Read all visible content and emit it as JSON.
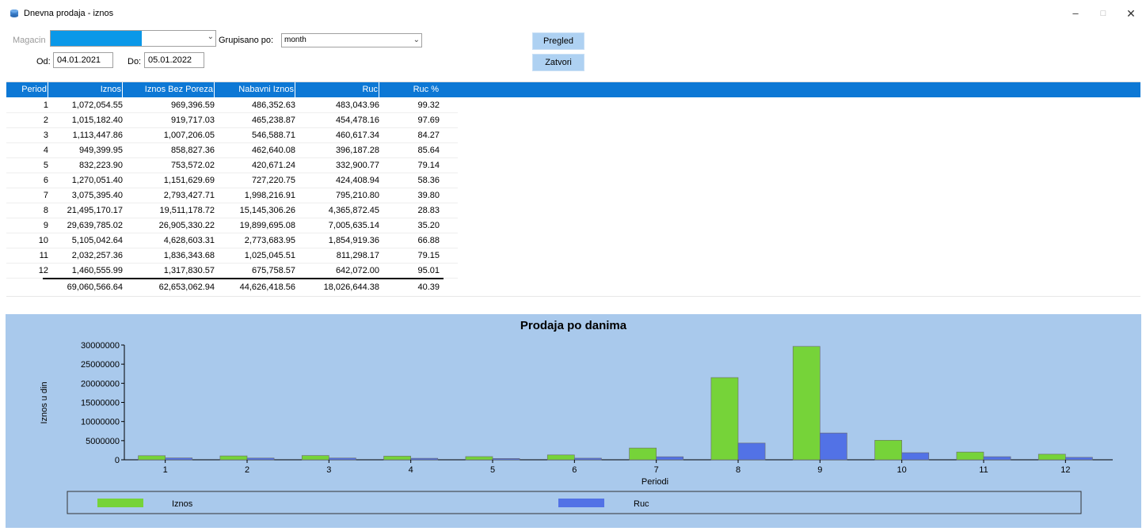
{
  "window": {
    "title": "Dnevna prodaja - iznos",
    "app_icon": "database-icon",
    "min_icon": "minimize-icon",
    "max_icon": "maximize-icon",
    "close_icon": "close-icon"
  },
  "filters": {
    "magacin_label": "Magacin",
    "grupisano_label": "Grupisano po:",
    "grupisano_value": "month",
    "od_label": "Od:",
    "od_value": "04.01.2021",
    "do_label": "Do:",
    "do_value": "05.01.2022",
    "selection_color": "#0a98e8"
  },
  "buttons": {
    "pregled": "Pregled",
    "zatvori": "Zatvori"
  },
  "grid": {
    "header_color": "#0d78d5",
    "columns": [
      "Period",
      "Iznos",
      "Iznos Bez Poreza",
      "Nabavni Iznos",
      "Ruc",
      "Ruc %"
    ],
    "rows": [
      [
        "1",
        "1,072,054.55",
        "969,396.59",
        "486,352.63",
        "483,043.96",
        "99.32"
      ],
      [
        "2",
        "1,015,182.40",
        "919,717.03",
        "465,238.87",
        "454,478.16",
        "97.69"
      ],
      [
        "3",
        "1,113,447.86",
        "1,007,206.05",
        "546,588.71",
        "460,617.34",
        "84.27"
      ],
      [
        "4",
        "949,399.95",
        "858,827.36",
        "462,640.08",
        "396,187.28",
        "85.64"
      ],
      [
        "5",
        "832,223.90",
        "753,572.02",
        "420,671.24",
        "332,900.77",
        "79.14"
      ],
      [
        "6",
        "1,270,051.40",
        "1,151,629.69",
        "727,220.75",
        "424,408.94",
        "58.36"
      ],
      [
        "7",
        "3,075,395.40",
        "2,793,427.71",
        "1,998,216.91",
        "795,210.80",
        "39.80"
      ],
      [
        "8",
        "21,495,170.17",
        "19,511,178.72",
        "15,145,306.26",
        "4,365,872.45",
        "28.83"
      ],
      [
        "9",
        "29,639,785.02",
        "26,905,330.22",
        "19,899,695.08",
        "7,005,635.14",
        "35.20"
      ],
      [
        "10",
        "5,105,042.64",
        "4,628,603.31",
        "2,773,683.95",
        "1,854,919.36",
        "66.88"
      ],
      [
        "11",
        "2,032,257.36",
        "1,836,343.68",
        "1,025,045.51",
        "811,298.17",
        "79.15"
      ],
      [
        "12",
        "1,460,555.99",
        "1,317,830.57",
        "675,758.57",
        "642,072.00",
        "95.01"
      ]
    ],
    "totals": [
      "",
      "69,060,566.64",
      "62,653,062.94",
      "44,626,418.56",
      "18,026,644.38",
      "40.39"
    ]
  },
  "chart_data": {
    "type": "bar",
    "title": "Prodaja po danima",
    "xlabel": "Periodi",
    "ylabel": "Iznos u din",
    "categories": [
      "1",
      "2",
      "3",
      "4",
      "5",
      "6",
      "7",
      "8",
      "9",
      "10",
      "11",
      "12"
    ],
    "ylim": [
      0,
      30000000
    ],
    "yticks": [
      "0",
      "5000000",
      "10000000",
      "15000000",
      "20000000",
      "25000000",
      "30000000"
    ],
    "legend_position": "bottom",
    "background_color": "#a9c9ec",
    "series": [
      {
        "name": "Iznos",
        "color": "#76d339",
        "values": [
          1072054.55,
          1015182.4,
          1113447.86,
          949399.95,
          832223.9,
          1270051.4,
          3075395.4,
          21495170.17,
          29639785.02,
          5105042.64,
          2032257.36,
          1460555.99
        ]
      },
      {
        "name": "Ruc",
        "color": "#5272e6",
        "values": [
          483043.96,
          454478.16,
          460617.34,
          396187.28,
          332900.77,
          424408.94,
          795210.8,
          4365872.45,
          7005635.14,
          1854919.36,
          811298.17,
          642072.0
        ]
      }
    ]
  }
}
